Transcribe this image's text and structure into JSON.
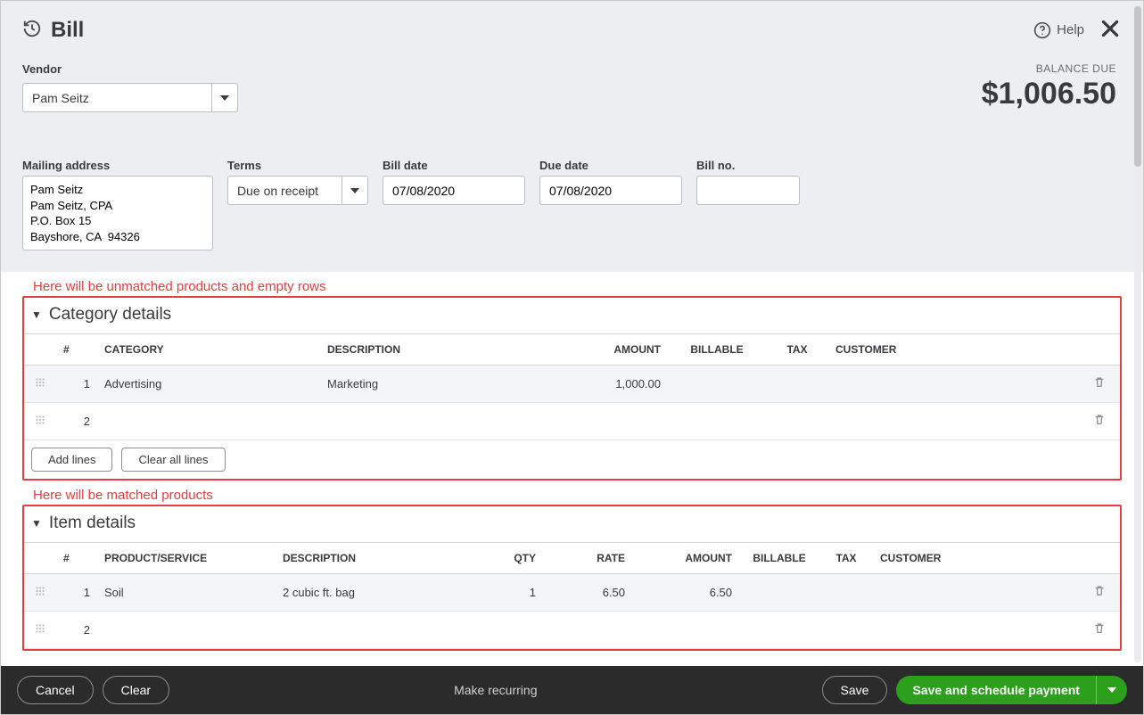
{
  "header": {
    "title": "Bill",
    "help": "Help"
  },
  "balance": {
    "label": "BALANCE DUE",
    "amount": "$1,006.50"
  },
  "vendor": {
    "label": "Vendor",
    "value": "Pam Seitz"
  },
  "mailing": {
    "label": "Mailing address",
    "value": "Pam Seitz\nPam Seitz, CPA\nP.O. Box 15\nBayshore, CA  94326"
  },
  "terms": {
    "label": "Terms",
    "value": "Due on receipt"
  },
  "bill_date": {
    "label": "Bill date",
    "value": "07/08/2020"
  },
  "due_date": {
    "label": "Due date",
    "value": "07/08/2020"
  },
  "bill_no": {
    "label": "Bill no.",
    "value": ""
  },
  "annotations": {
    "category": "Here will be unmatched products and empty rows",
    "item": "Here will be matched products"
  },
  "category_section": {
    "title": "Category details",
    "columns": {
      "idx": "#",
      "category": "CATEGORY",
      "description": "DESCRIPTION",
      "amount": "AMOUNT",
      "billable": "BILLABLE",
      "tax": "TAX",
      "customer": "CUSTOMER"
    },
    "rows": [
      {
        "idx": "1",
        "category": "Advertising",
        "description": "Marketing",
        "amount": "1,000.00",
        "billable": "",
        "tax": "",
        "customer": ""
      },
      {
        "idx": "2",
        "category": "",
        "description": "",
        "amount": "",
        "billable": "",
        "tax": "",
        "customer": ""
      }
    ],
    "add_lines": "Add lines",
    "clear_lines": "Clear all lines"
  },
  "item_section": {
    "title": "Item details",
    "columns": {
      "idx": "#",
      "product": "PRODUCT/SERVICE",
      "description": "DESCRIPTION",
      "qty": "QTY",
      "rate": "RATE",
      "amount": "AMOUNT",
      "billable": "BILLABLE",
      "tax": "TAX",
      "customer": "CUSTOMER"
    },
    "rows": [
      {
        "idx": "1",
        "product": "Soil",
        "description": "2 cubic ft. bag",
        "qty": "1",
        "rate": "6.50",
        "amount": "6.50",
        "billable": "",
        "tax": "",
        "customer": ""
      },
      {
        "idx": "2",
        "product": "",
        "description": "",
        "qty": "",
        "rate": "",
        "amount": "",
        "billable": "",
        "tax": "",
        "customer": ""
      }
    ]
  },
  "footer": {
    "cancel": "Cancel",
    "clear": "Clear",
    "recurring": "Make recurring",
    "save": "Save",
    "primary": "Save and schedule payment"
  }
}
